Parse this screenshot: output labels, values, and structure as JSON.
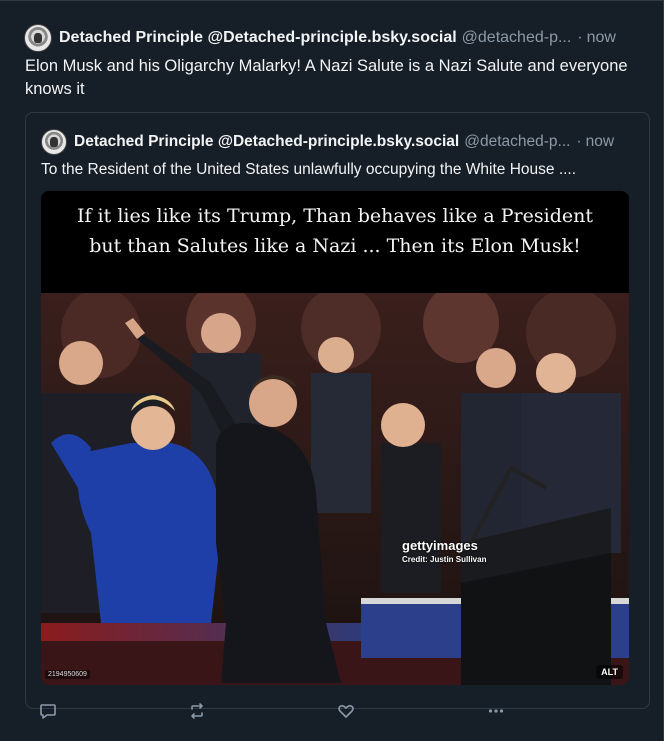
{
  "colors": {
    "background": "#161e27",
    "border": "#2e3a46",
    "text_primary": "#f1f3f5",
    "text_secondary": "#8c9aa8"
  },
  "post": {
    "author_display_name": "Detached Principle @Detached-principle.bsky.social",
    "author_handle": "@detached-p...",
    "separator": "·",
    "timestamp": "now",
    "text": "Elon Musk and his Oligarchy Malarky! A Nazi Salute is a Nazi Salute and everyone knows it",
    "avatar_icon": "avatar-icon"
  },
  "quote": {
    "author_display_name": "Detached Principle @Detached-principle.bsky.social",
    "author_handle": "@detached-p...",
    "separator": "·",
    "timestamp": "now",
    "text": "To the Resident of the United States unlawfully  occupying the White House ....",
    "media": {
      "caption_line1": "If it lies like its Trump, Than behaves like a President",
      "caption_line2": "but than Salutes like a Nazi ... Then its Elon Musk!",
      "watermark_brand": "gettyimages",
      "watermark_credit": "Credit: Justin Sullivan",
      "image_id": "2194950609",
      "alt_badge": "ALT"
    }
  },
  "actions": {
    "reply_icon": "reply-icon",
    "repost_icon": "repost-icon",
    "like_icon": "heart-icon",
    "more_icon": "more-options-icon"
  }
}
